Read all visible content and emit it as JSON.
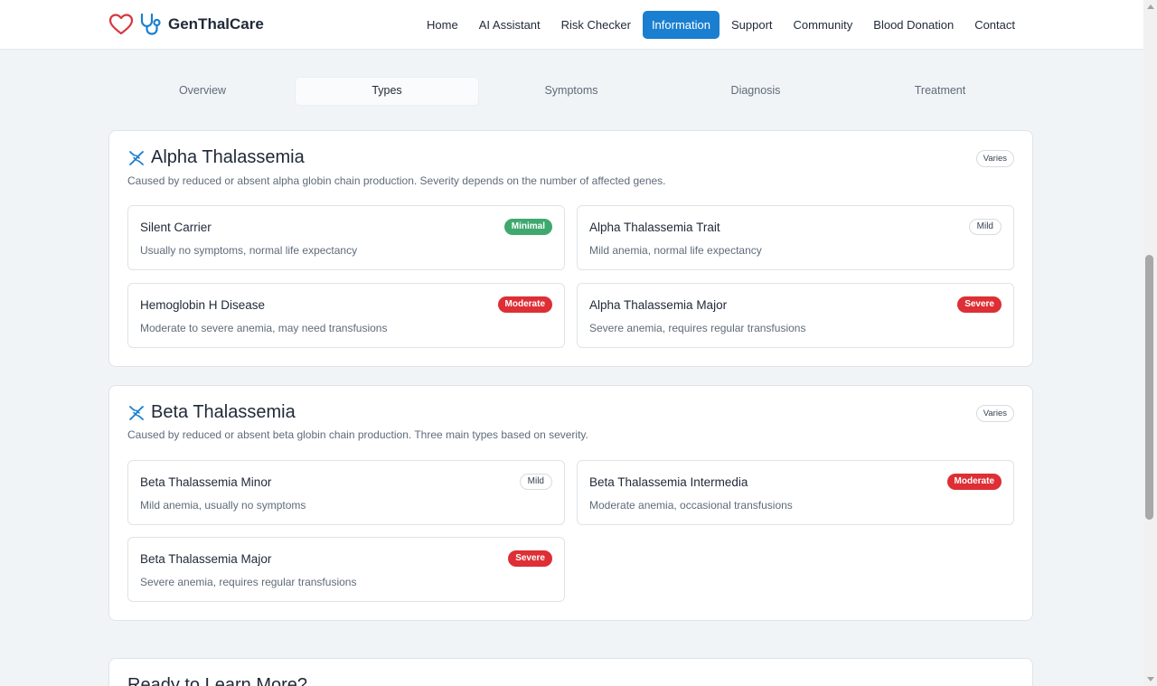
{
  "header": {
    "brand": "GenThalCare",
    "nav": [
      "Home",
      "AI Assistant",
      "Risk Checker",
      "Information",
      "Support",
      "Community",
      "Blood Donation",
      "Contact"
    ],
    "active_nav": "Information"
  },
  "tabs": [
    "Overview",
    "Types",
    "Symptoms",
    "Diagnosis",
    "Treatment"
  ],
  "active_tab": "Types",
  "alpha": {
    "title": "Alpha Thalassemia",
    "badge": "Varies",
    "description": "Caused by reduced or absent alpha globin chain production. Severity depends on the number of affected genes.",
    "items": [
      {
        "title": "Silent Carrier",
        "desc": "Usually no symptoms, normal life expectancy",
        "severity": "Minimal"
      },
      {
        "title": "Alpha Thalassemia Trait",
        "desc": "Mild anemia, normal life expectancy",
        "severity": "Mild"
      },
      {
        "title": "Hemoglobin H Disease",
        "desc": "Moderate to severe anemia, may need transfusions",
        "severity": "Moderate"
      },
      {
        "title": "Alpha Thalassemia Major",
        "desc": "Severe anemia, requires regular transfusions",
        "severity": "Severe"
      }
    ]
  },
  "beta": {
    "title": "Beta Thalassemia",
    "badge": "Varies",
    "description": "Caused by reduced or absent beta globin chain production. Three main types based on severity.",
    "items": [
      {
        "title": "Beta Thalassemia Minor",
        "desc": "Mild anemia, usually no symptoms",
        "severity": "Mild"
      },
      {
        "title": "Beta Thalassemia Intermedia",
        "desc": "Moderate anemia, occasional transfusions",
        "severity": "Moderate"
      },
      {
        "title": "Beta Thalassemia Major",
        "desc": "Severe anemia, requires regular transfusions",
        "severity": "Severe"
      }
    ]
  },
  "cta": {
    "title": "Ready to Learn More?"
  },
  "colors": {
    "accent": "#1a7fd0",
    "minimal": "#3fa86f",
    "severe": "#dd2f35",
    "heart": "#d9363e"
  },
  "icons": {
    "logo": [
      "heart-icon",
      "stethoscope-icon"
    ],
    "section": "dna-icon"
  }
}
